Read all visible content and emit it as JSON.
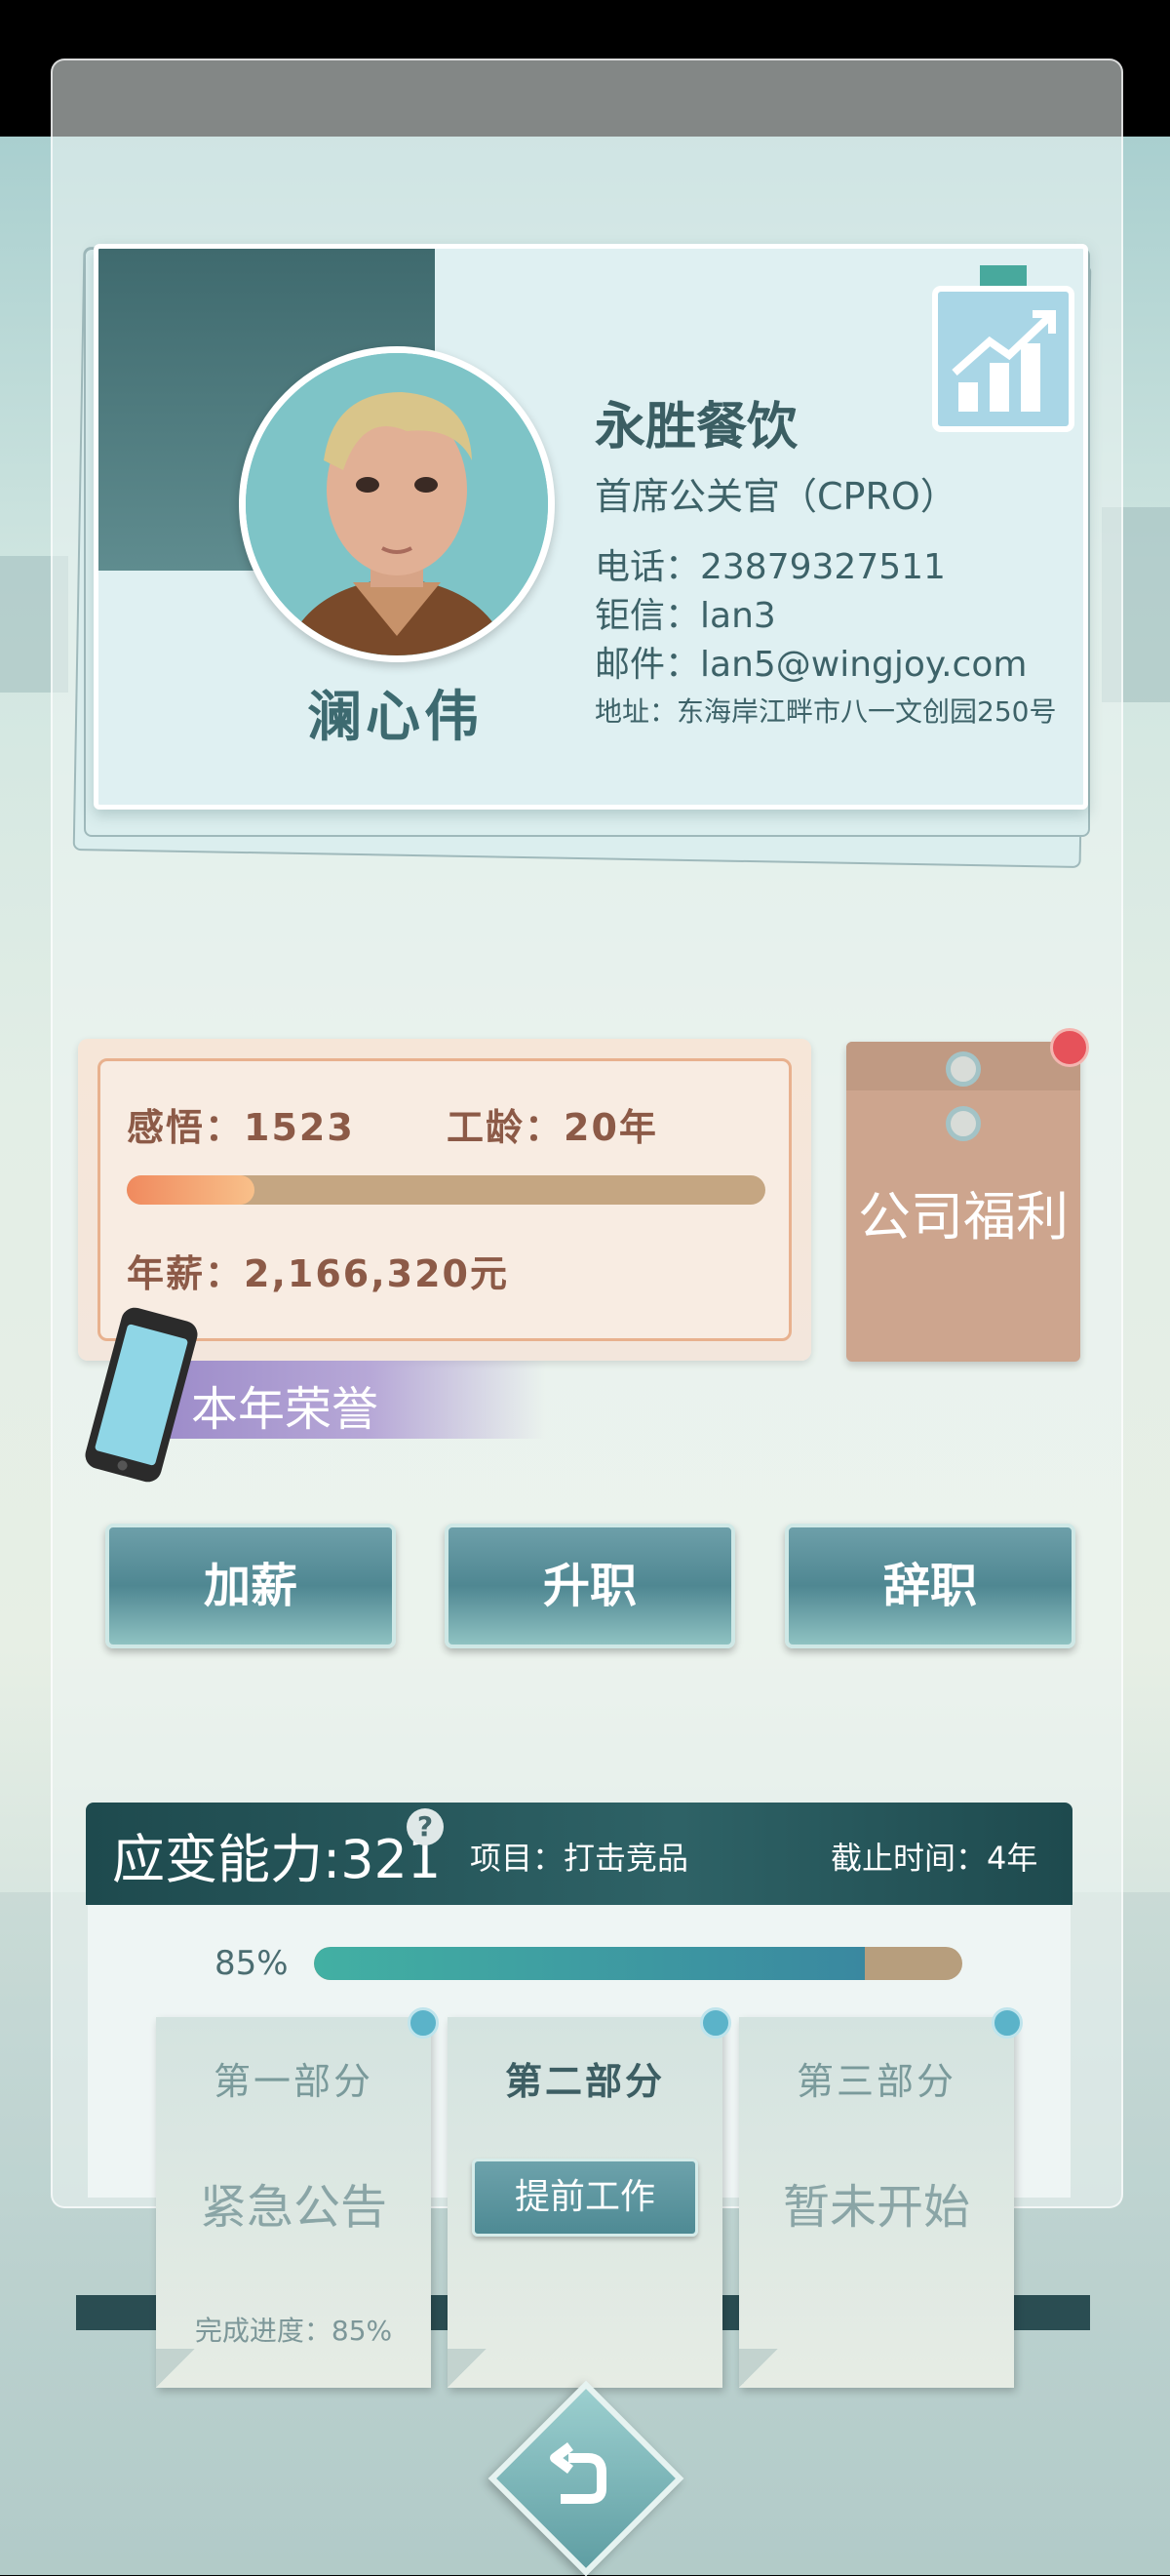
{
  "profile": {
    "name": "澜心伟",
    "company": "永胜餐饮",
    "title": "首席公关官（CPRO）",
    "phone": "电话：23879327511",
    "chat": "钜信：lan3",
    "email": "邮件：lan5@wingjoy.com",
    "address": "地址：东海岸江畔市八一文创园250号"
  },
  "stats": {
    "insight": "感悟：1523",
    "seniority": "工龄：20年",
    "salary": "年薪：2,166,320元",
    "progress_fraction": 0.2
  },
  "welfare": {
    "label": "公司福利",
    "has_notification": true
  },
  "honor": {
    "label": "本年荣誉"
  },
  "actions": {
    "raise": "加薪",
    "promote": "升职",
    "resign": "辞职"
  },
  "challenge": {
    "ability": "应变能力:321",
    "help": "?",
    "project": "项目：打击竞品",
    "deadline": "截止时间：4年",
    "percent_label": "85%",
    "percent_value": 0.85,
    "parts": [
      {
        "title": "第一部分",
        "status": "紧急公告",
        "progress": "完成进度：85%"
      },
      {
        "title": "第二部分",
        "button": "提前工作"
      },
      {
        "title": "第三部分",
        "status": "暂未开始"
      }
    ]
  },
  "colors": {
    "accent": "#2e6266",
    "salary_bar": "#f08a5e",
    "notification": "#e6525a"
  },
  "icons": {
    "back": "back-arrow-icon",
    "chart": "growth-chart-icon",
    "phone": "phone-icon"
  }
}
